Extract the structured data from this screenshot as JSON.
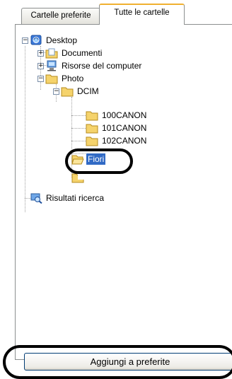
{
  "tabs": [
    {
      "label": "Cartelle preferite",
      "active": false
    },
    {
      "label": "Tutte le cartelle",
      "active": true
    }
  ],
  "tree": {
    "desktop": {
      "label": "Desktop",
      "expanded": true,
      "icon": "desktop-icon"
    },
    "documenti": {
      "label": "Documenti",
      "expanded": false,
      "icon": "documents-folder-icon"
    },
    "risorse": {
      "label": "Risorse del computer",
      "expanded": false,
      "icon": "my-computer-icon"
    },
    "photo": {
      "label": "Photo",
      "expanded": true,
      "icon": "folder-icon"
    },
    "dcim": {
      "label": "DCIM",
      "expanded": true,
      "icon": "folder-icon"
    },
    "c100": {
      "label": "100CANON",
      "icon": "folder-icon"
    },
    "c101": {
      "label": "101CANON",
      "icon": "folder-icon"
    },
    "c102": {
      "label": "102CANON",
      "icon": "folder-icon"
    },
    "fiori": {
      "label": "Fiori",
      "selected": true,
      "icon": "open-folder-icon"
    },
    "risultati": {
      "label": "Risultati ricerca",
      "icon": "search-results-icon"
    }
  },
  "button": {
    "label": "Aggiungi a preferite"
  },
  "colors": {
    "selection": "#316ac5",
    "tab_highlight": "#f0b030",
    "folder": "#f5d36c"
  }
}
